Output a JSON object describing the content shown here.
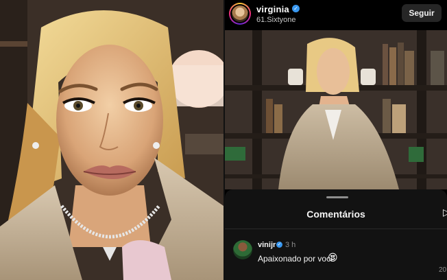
{
  "post": {
    "username": "virginia",
    "subtitle": "61.Sixtyone",
    "follow_label": "Seguir",
    "verified_glyph": "✓"
  },
  "comments_sheet": {
    "title": "Comentários",
    "comment": {
      "username": "vinijr",
      "verified_glyph": "✓",
      "time": "3 h",
      "text": "Apaixonado por você",
      "emoji": "😍"
    },
    "corner_text": "20"
  },
  "icons": {
    "avatar": "story-ring-avatar",
    "verified": "verified-badge-icon",
    "drag": "drag-handle",
    "share": "share-icon"
  },
  "colors": {
    "background": "#000000",
    "sheet": "#121212",
    "verified": "#3897f0",
    "follow_button": "#262626"
  }
}
